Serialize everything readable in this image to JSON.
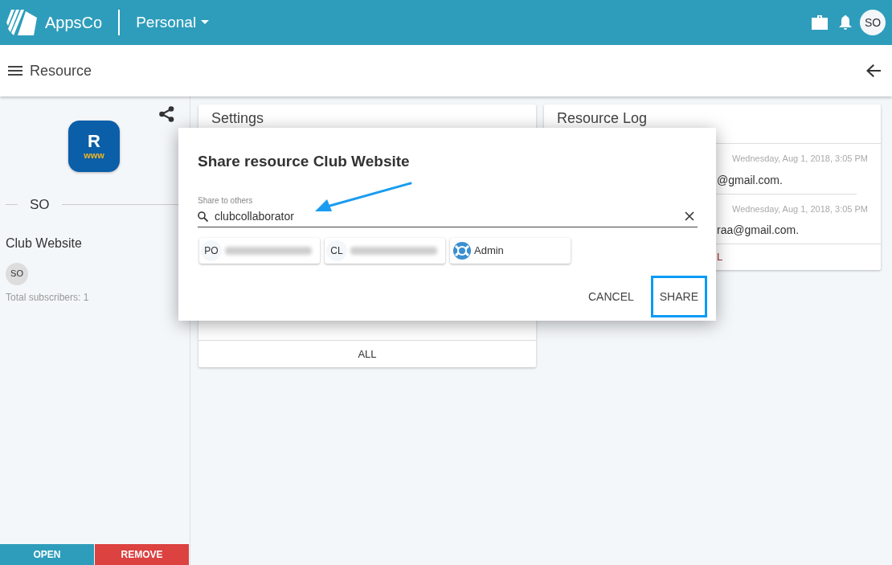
{
  "app_bar": {
    "brand": "AppsCo",
    "workspace": "Personal",
    "avatar": "SO"
  },
  "toolbar": {
    "title": "Resource"
  },
  "sidebar": {
    "app_icon": {
      "letter": "R",
      "caption": "www"
    },
    "section_label": "SO",
    "resource_name": "Club Website",
    "subscriber_avatar": "SO",
    "subscribers_text": "Total subscribers: 1",
    "buttons": [
      {
        "label": "OPEN",
        "kind": "primary"
      },
      {
        "label": "REMOVE",
        "kind": "danger"
      }
    ]
  },
  "settings_card": {
    "title": "Settings",
    "footer_button": "ALL"
  },
  "log_card": {
    "title": "Resource Log",
    "entries": [
      {
        "time": "Wednesday, Aug 1, 2018, 3:05 PM",
        "text": "@gmail.com."
      },
      {
        "time": "Wednesday, Aug 1, 2018, 3:05 PM",
        "text": "raa@gmail.com."
      }
    ],
    "footer_button": "L"
  },
  "dialog": {
    "title": "Share resource Club Website",
    "field": {
      "label": "Share to others",
      "value": "clubcollaborator"
    },
    "results": [
      {
        "kind": "initials",
        "initials": "PO"
      },
      {
        "kind": "initials",
        "initials": "CL"
      },
      {
        "kind": "icon",
        "label": "Admin"
      }
    ],
    "buttons": [
      {
        "label": "CANCEL",
        "highlighted": false
      },
      {
        "label": "SHARE",
        "highlighted": true
      }
    ]
  }
}
